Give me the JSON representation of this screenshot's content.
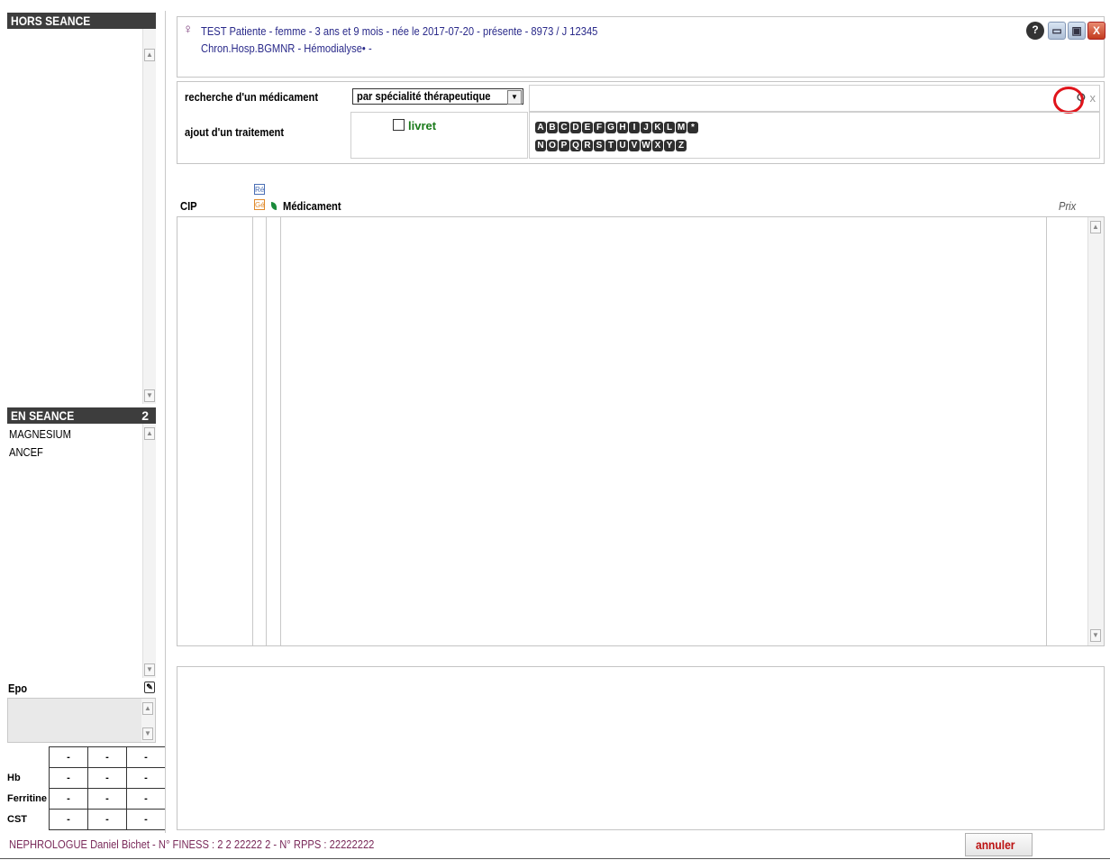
{
  "left": {
    "hors_seance": {
      "title": "HORS SEANCE",
      "items": []
    },
    "en_seance": {
      "title": "EN SEANCE",
      "count": "2",
      "items": [
        "MAGNESIUM",
        "ANCEF"
      ]
    },
    "epo": {
      "label": "Epo",
      "button_icon": "edit-icon"
    },
    "labs": {
      "rows": [
        {
          "label": "",
          "values": [
            "-",
            "-",
            "-"
          ]
        },
        {
          "label": "Hb",
          "values": [
            "-",
            "-",
            "-"
          ]
        },
        {
          "label": "Ferritine",
          "values": [
            "-",
            "-",
            "-"
          ]
        },
        {
          "label": "CST",
          "values": [
            "-",
            "-",
            "-"
          ]
        }
      ]
    }
  },
  "header": {
    "patient_line1": "TEST Patiente - femme - 3 ans et 9 mois - née le 2017-07-20 - présente - 8973 / J 12345",
    "patient_line2": "Chron.Hosp.BGMNR - Hémodialyse• -",
    "gender_icon": "female-symbol-icon",
    "window_buttons": {
      "help": "?",
      "minimize": "▭",
      "maximize": "▣",
      "close": "X"
    }
  },
  "search": {
    "label": "recherche d'un médicament",
    "select_value": "par spécialité thérapeutique",
    "input_value": "",
    "clear_label": "x",
    "search_icon": "magnifier-icon"
  },
  "add_treatment": {
    "label": "ajout d'un traitement",
    "livret_label": "livret",
    "livret_checked": false,
    "letters_row1": [
      "A",
      "B",
      "C",
      "D",
      "E",
      "F",
      "G",
      "H",
      "I",
      "J",
      "K",
      "L",
      "M",
      "*"
    ],
    "letters_row2": [
      "N",
      "O",
      "P",
      "Q",
      "R",
      "S",
      "T",
      "U",
      "V",
      "W",
      "X",
      "Y",
      "Z"
    ]
  },
  "table": {
    "col_cip": "CIP",
    "badge_re": "Ré",
    "badge_ge": "Gé",
    "col_medicament": "Médicament",
    "col_prix": "Prix",
    "rows": []
  },
  "footer": {
    "text": "NEPHROLOGUE Daniel Bichet - N° FINESS : 2 2 22222 2 - N° RPPS : 22222222",
    "cancel_label": "annuler"
  },
  "colors": {
    "accent_red": "#e0141b",
    "header_dark": "#3d3d3d",
    "patient_blue": "#2a2a8a",
    "livret_green": "#1a7a1a"
  }
}
